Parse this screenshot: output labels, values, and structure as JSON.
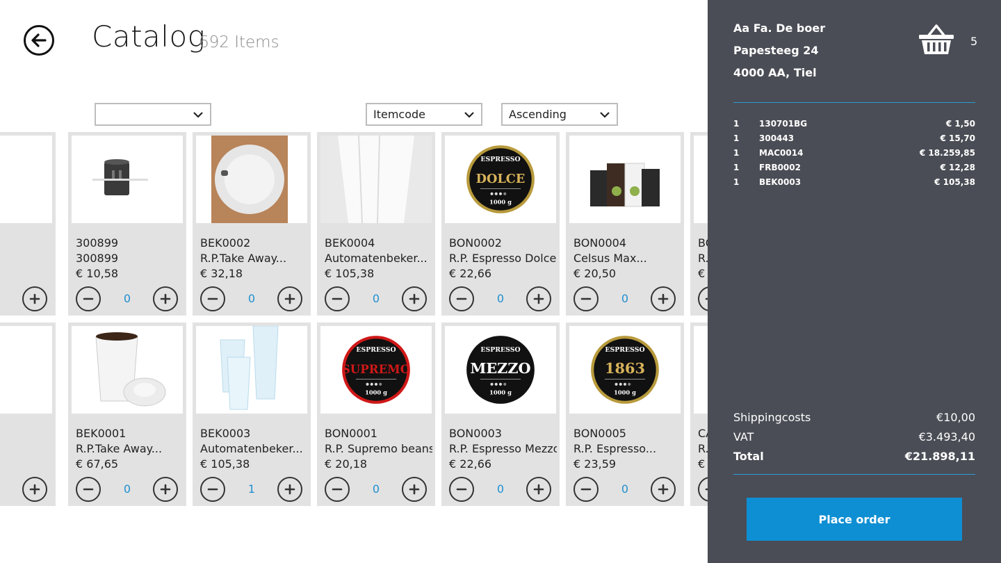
{
  "header": {
    "title": "Catalog",
    "count": "692 Items"
  },
  "filters": {
    "category": "",
    "sort_field": "Itemcode",
    "sort_order": "Ascending"
  },
  "catalog": {
    "row1": [
      {
        "code": "",
        "name": "",
        "price": "",
        "qty": "0",
        "image": "orange-tool"
      },
      {
        "code": "300899",
        "name": "300899",
        "price": "€ 10,58",
        "qty": "0",
        "image": "black-cylinder"
      },
      {
        "code": "BEK0002",
        "name": "R.P.Take Away...",
        "price": "€ 32,18",
        "qty": "0",
        "image": "cup-lid"
      },
      {
        "code": "BEK0004",
        "name": "Automatenbeker...",
        "price": "€ 105,38",
        "qty": "0",
        "image": "white-cup"
      },
      {
        "code": "BON0002",
        "name": "R.P. Espresso Dolce.",
        "price": "€ 22,66",
        "qty": "0",
        "image": "espresso-dolce"
      },
      {
        "code": "BON0004",
        "name": "Celsus Max...",
        "price": "€ 20,50",
        "qty": "0",
        "image": "coffee-bags"
      },
      {
        "code": "BO",
        "name": "R.",
        "price": "€",
        "qty": "",
        "image": "blank"
      }
    ],
    "row2": [
      {
        "code": "",
        "name": "",
        "price": "",
        "qty": "0",
        "image": "yellow-stick"
      },
      {
        "code": "BEK0001",
        "name": "R.P.Take Away...",
        "price": "€ 67,65",
        "qty": "0",
        "image": "takeaway-cup"
      },
      {
        "code": "BEK0003",
        "name": "Automatenbeker...",
        "price": "€ 105,38",
        "qty": "1",
        "image": "cup-stack"
      },
      {
        "code": "BON0001",
        "name": "R.P. Supremo beans",
        "price": "€ 20,18",
        "qty": "0",
        "image": "espresso-supremo"
      },
      {
        "code": "BON0003",
        "name": "R.P. Espresso Mezzo",
        "price": "€ 22,66",
        "qty": "0",
        "image": "espresso-mezzo"
      },
      {
        "code": "BON0005",
        "name": "R.P. Espresso...",
        "price": "€ 23,59",
        "qty": "0",
        "image": "espresso-1863"
      },
      {
        "code": "CA",
        "name": "R.",
        "price": "€",
        "qty": "",
        "image": "blank"
      }
    ],
    "labels": {
      "espresso": "ESPRESSO",
      "dolce": "DOLCE",
      "supremo": "SUPREMO",
      "mezzo": "MEZZO",
      "year": "1863",
      "weight": "1000 g"
    }
  },
  "customer": {
    "name": "Aa Fa. De boer",
    "street": "Papesteeg 24",
    "city": "4000 AA, Tiel"
  },
  "basket": {
    "count": "5",
    "icon": "basket-icon"
  },
  "order_lines": [
    {
      "qty": "1",
      "code": "130701BG",
      "price": "€ 1,50"
    },
    {
      "qty": "1",
      "code": "300443",
      "price": "€ 15,70"
    },
    {
      "qty": "1",
      "code": "MAC0014",
      "price": "€ 18.259,85"
    },
    {
      "qty": "1",
      "code": "FRB0002",
      "price": "€ 12,28"
    },
    {
      "qty": "1",
      "code": "BEK0003",
      "price": "€ 105,38"
    }
  ],
  "totals": {
    "shipping_label": "Shippingcosts",
    "shipping": "€10,00",
    "vat_label": "VAT",
    "vat": "€3.493,40",
    "total_label": "Total",
    "total": "€21.898,11"
  },
  "actions": {
    "place_order": "Place order"
  },
  "colors": {
    "panel": "#4a4d55",
    "accent": "#0f8fd3",
    "qty": "#1f8fd0",
    "card": "#e2e2e2"
  }
}
